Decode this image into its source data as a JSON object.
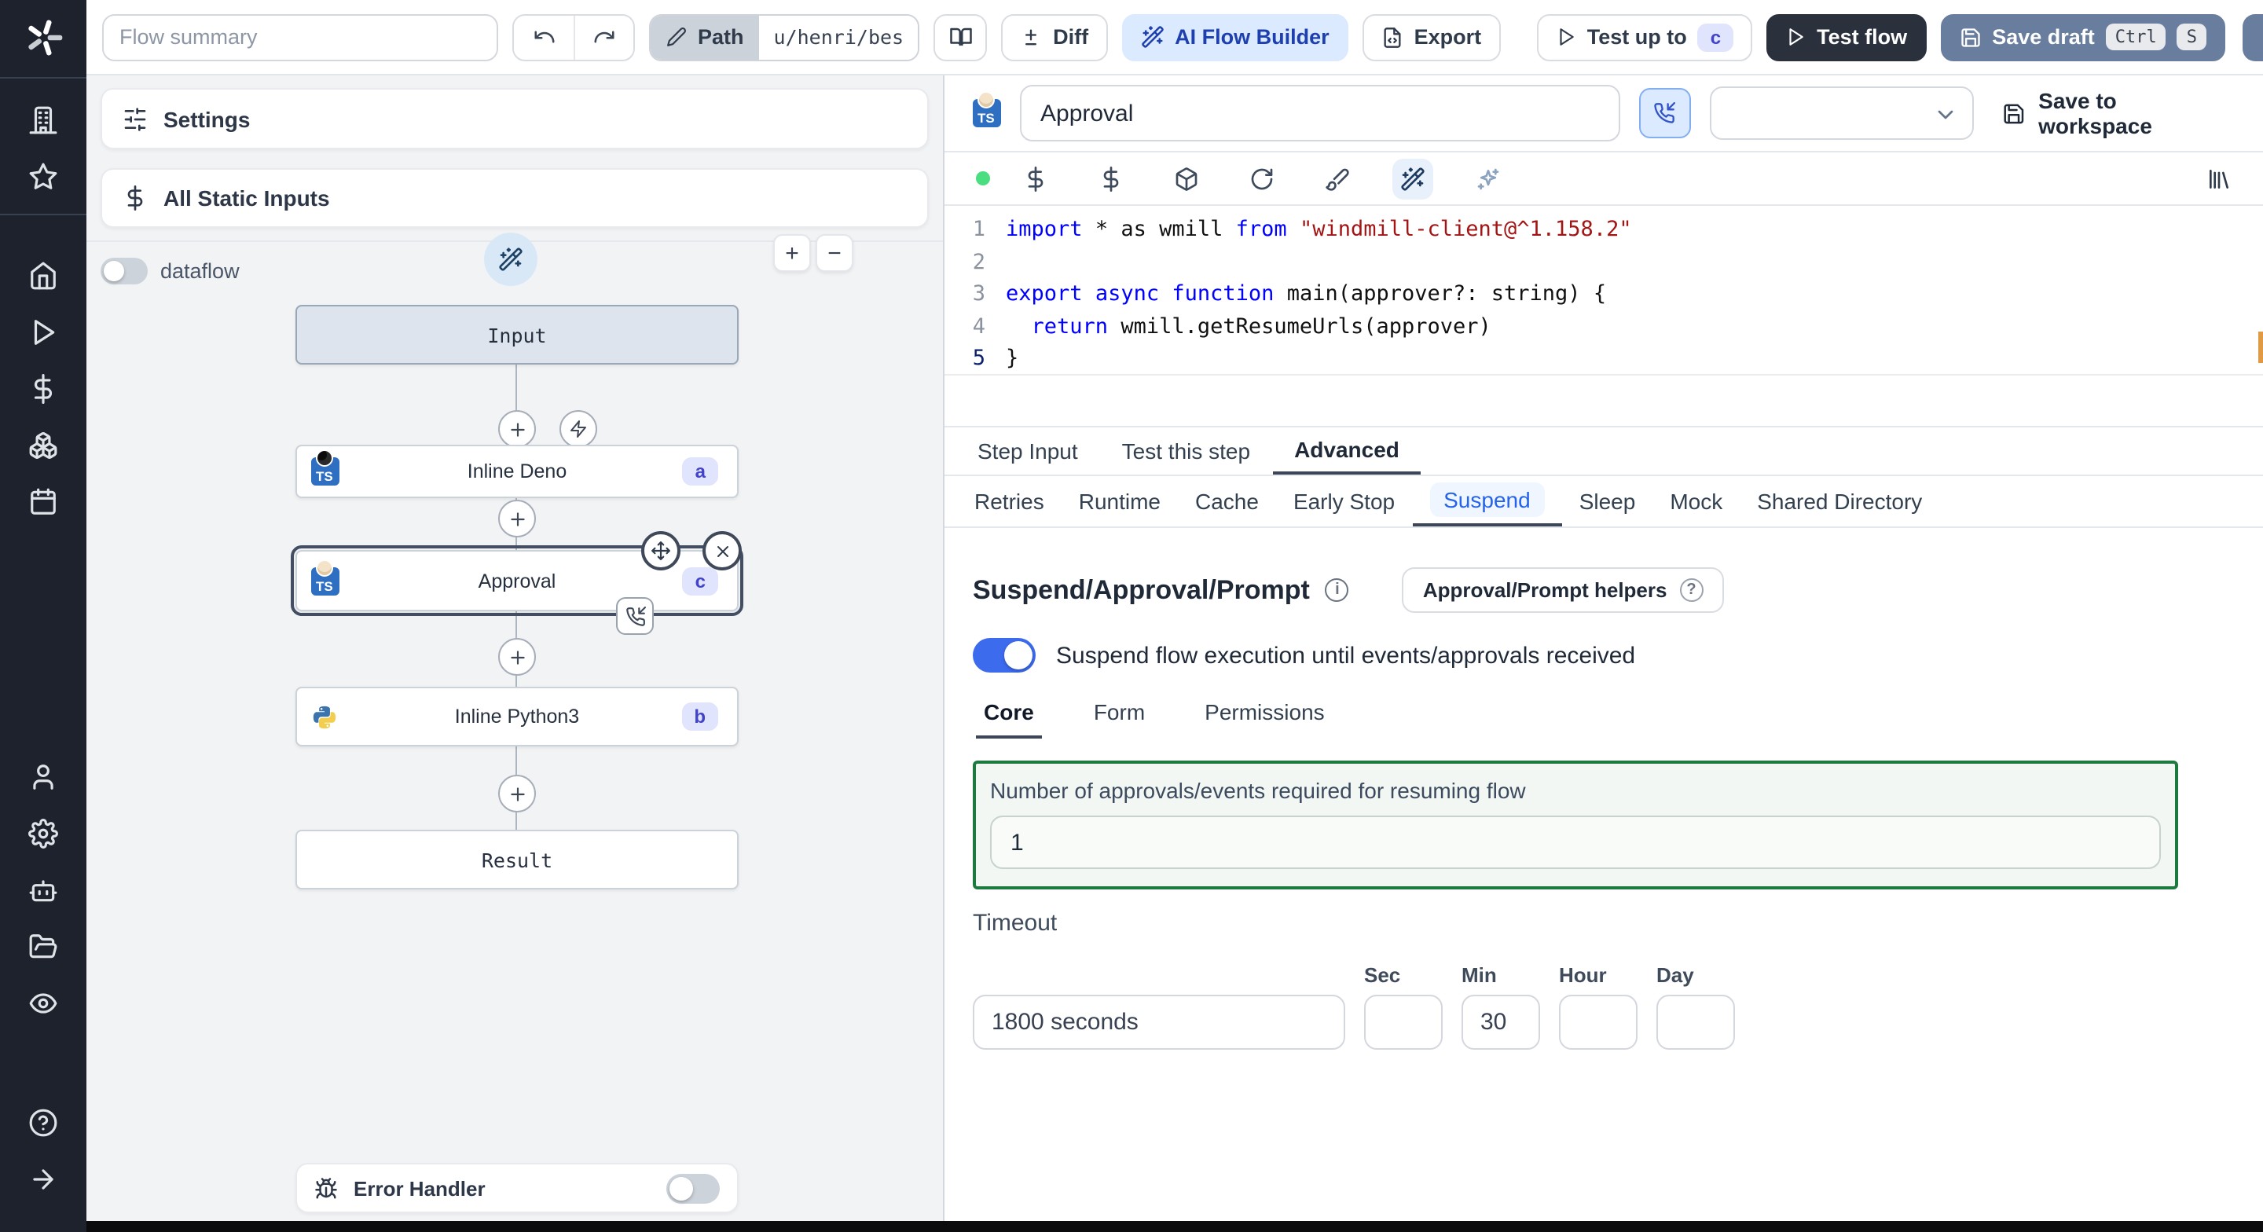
{
  "topbar": {
    "flow_summary_placeholder": "Flow summary",
    "path_label": "Path",
    "path_value": "u/henri/bes",
    "diff_label": "Diff",
    "ai_flow_builder_label": "AI Flow Builder",
    "export_label": "Export",
    "test_up_to_label": "Test up to",
    "test_up_to_badge": "c",
    "test_flow_label": "Test flow",
    "save_draft_label": "Save draft",
    "kbd_ctrl": "Ctrl",
    "kbd_s": "S"
  },
  "flow_panel": {
    "settings_label": "Settings",
    "static_inputs_label": "All Static Inputs",
    "dataflow_label": "dataflow",
    "error_handler_label": "Error Handler",
    "input_node_label": "Input",
    "result_node_label": "Result",
    "ts_icon_label": "TS",
    "modules": {
      "deno": {
        "label": "Inline Deno",
        "badge": "a"
      },
      "approval": {
        "label": "Approval",
        "badge": "c"
      },
      "python": {
        "label": "Inline Python3",
        "badge": "b"
      }
    }
  },
  "step_panel": {
    "title_value": "Approval",
    "save_to_workspace_label": "Save to workspace",
    "tabs": [
      {
        "label": "Step Input"
      },
      {
        "label": "Test this step"
      },
      {
        "label": "Advanced"
      }
    ],
    "subtabs": [
      {
        "label": "Retries"
      },
      {
        "label": "Runtime"
      },
      {
        "label": "Cache"
      },
      {
        "label": "Early Stop"
      },
      {
        "label": "Suspend"
      },
      {
        "label": "Sleep"
      },
      {
        "label": "Mock"
      },
      {
        "label": "Shared Directory"
      }
    ],
    "suspend": {
      "heading": "Suspend/Approval/Prompt",
      "helpers_button_label": "Approval/Prompt helpers",
      "toggle_label": "Suspend flow execution until events/approvals received",
      "mode_tabs": [
        {
          "label": "Core"
        },
        {
          "label": "Form"
        },
        {
          "label": "Permissions"
        }
      ],
      "approvals_label": "Number of approvals/events required for resuming flow",
      "approvals_value": "1",
      "timeout_label": "Timeout",
      "timeout_value": "1800 seconds",
      "unit_sec": "Sec",
      "unit_min": "Min",
      "unit_hour": "Hour",
      "unit_day": "Day",
      "min_value": "30"
    }
  },
  "code": {
    "line_numbers": [
      "1",
      "2",
      "3",
      "4",
      "5"
    ],
    "l1": {
      "k1": "import",
      "mid": " * as wmill ",
      "k2": "from",
      "str": " \"windmill-client@^1.158.2\""
    },
    "l3": {
      "k1": "export ",
      "k2": "async ",
      "k3": "function ",
      "rest": "main(approver?: string) {"
    },
    "l4": {
      "indent": "  ",
      "k": "return ",
      "rest": "wmill.getResumeUrls(approver)"
    },
    "l5": {
      "t": "}"
    }
  },
  "colors": {
    "accent_blue": "#3d6bee",
    "selected_node_outline": "#434e63",
    "green_border": "#1d7a3f",
    "status_dot": "#4ade80"
  }
}
